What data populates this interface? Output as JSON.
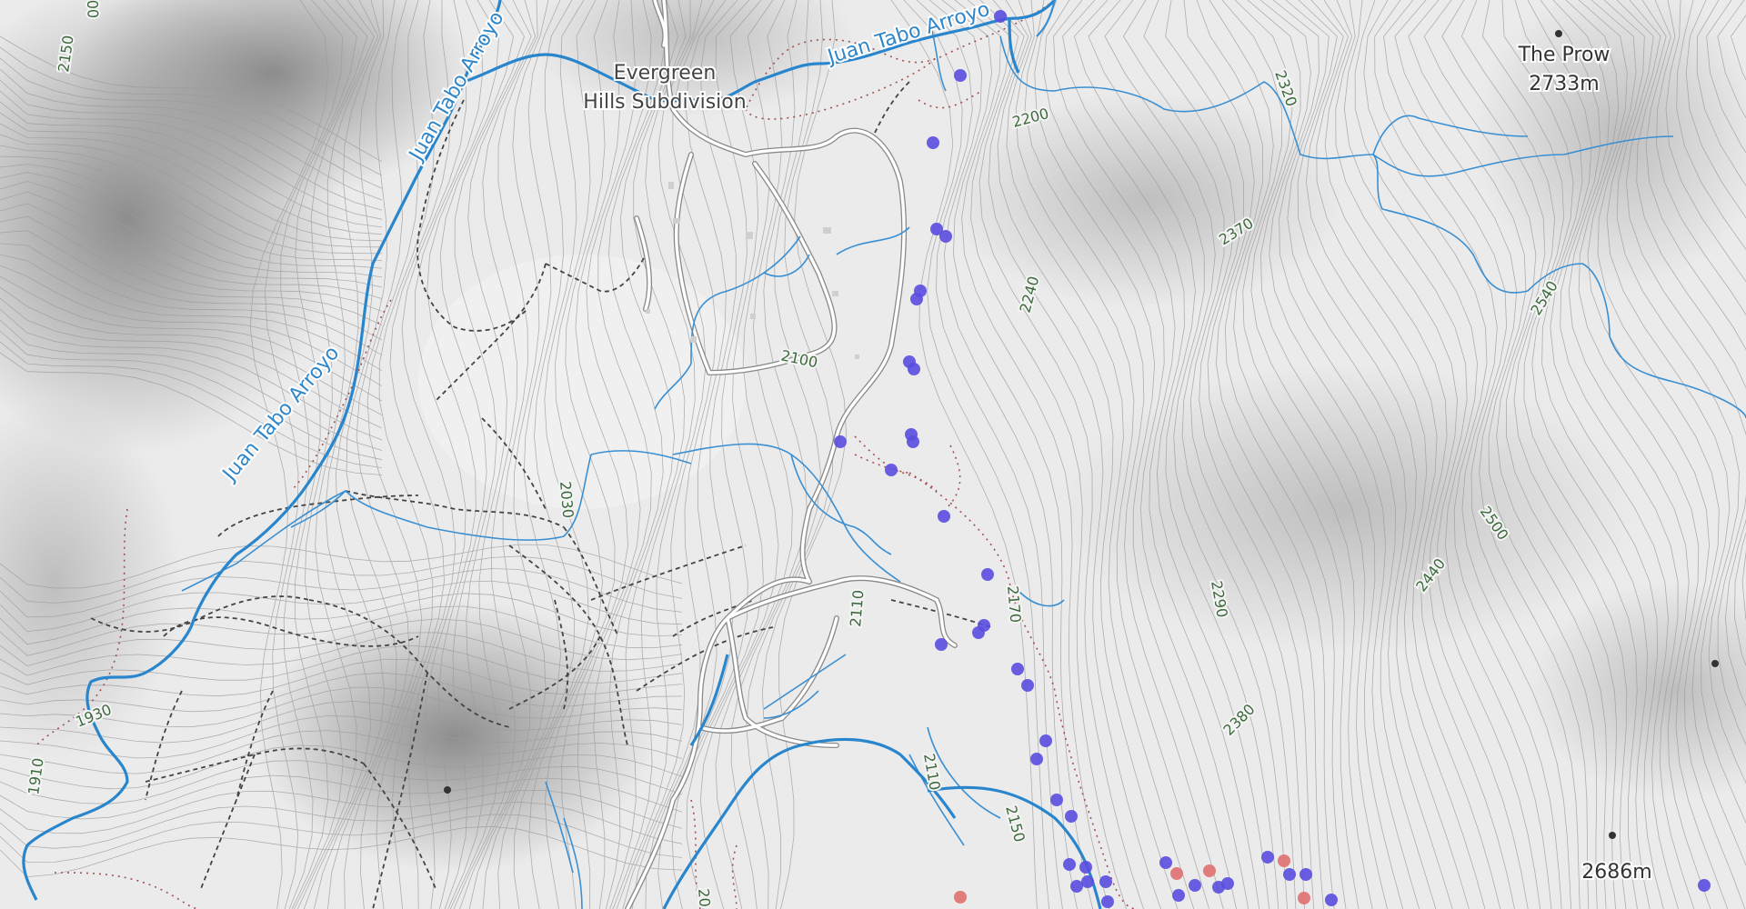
{
  "map": {
    "colors": {
      "background": "#ebebeb",
      "contour": "#9a9a9a",
      "stream": "#3a8fd2",
      "arroyo": "#2a86cc",
      "road_casing": "#8a8a8a",
      "road_fill": "#ffffff",
      "trail": "#444444",
      "boundary": "#a05050",
      "marker_blue": "#5a4ee0",
      "marker_red": "#e07070",
      "contour_label": "#3d6a3d"
    },
    "contour_labels": [
      {
        "text": "2150"
      },
      {
        "text": "2200"
      },
      {
        "text": "2320"
      },
      {
        "text": "2370"
      },
      {
        "text": "2240"
      },
      {
        "text": "2100"
      },
      {
        "text": "2540"
      },
      {
        "text": "2030"
      },
      {
        "text": "2500"
      },
      {
        "text": "2290"
      },
      {
        "text": "2440"
      },
      {
        "text": "2110"
      },
      {
        "text": "2170"
      },
      {
        "text": "2380"
      },
      {
        "text": "1930"
      },
      {
        "text": "1910"
      },
      {
        "text": "2110"
      },
      {
        "text": "2150"
      },
      {
        "text": "20"
      },
      {
        "text": "00"
      }
    ],
    "stream_labels": [
      {
        "text": "Juan Tabo Arroyo"
      },
      {
        "text": "Juan Tabo Arroyo"
      },
      {
        "text": "Juan Tabo Arroyo"
      }
    ],
    "places": [
      {
        "line1": "Evergreen",
        "line2": "Hills Subdivision"
      }
    ],
    "peaks": [
      {
        "name": "The Prow",
        "elevation": "2733m"
      },
      {
        "name": "",
        "elevation": "2686m"
      }
    ],
    "marker_groups": {
      "blue_count_hint": "many",
      "red_count_hint": "several"
    }
  }
}
